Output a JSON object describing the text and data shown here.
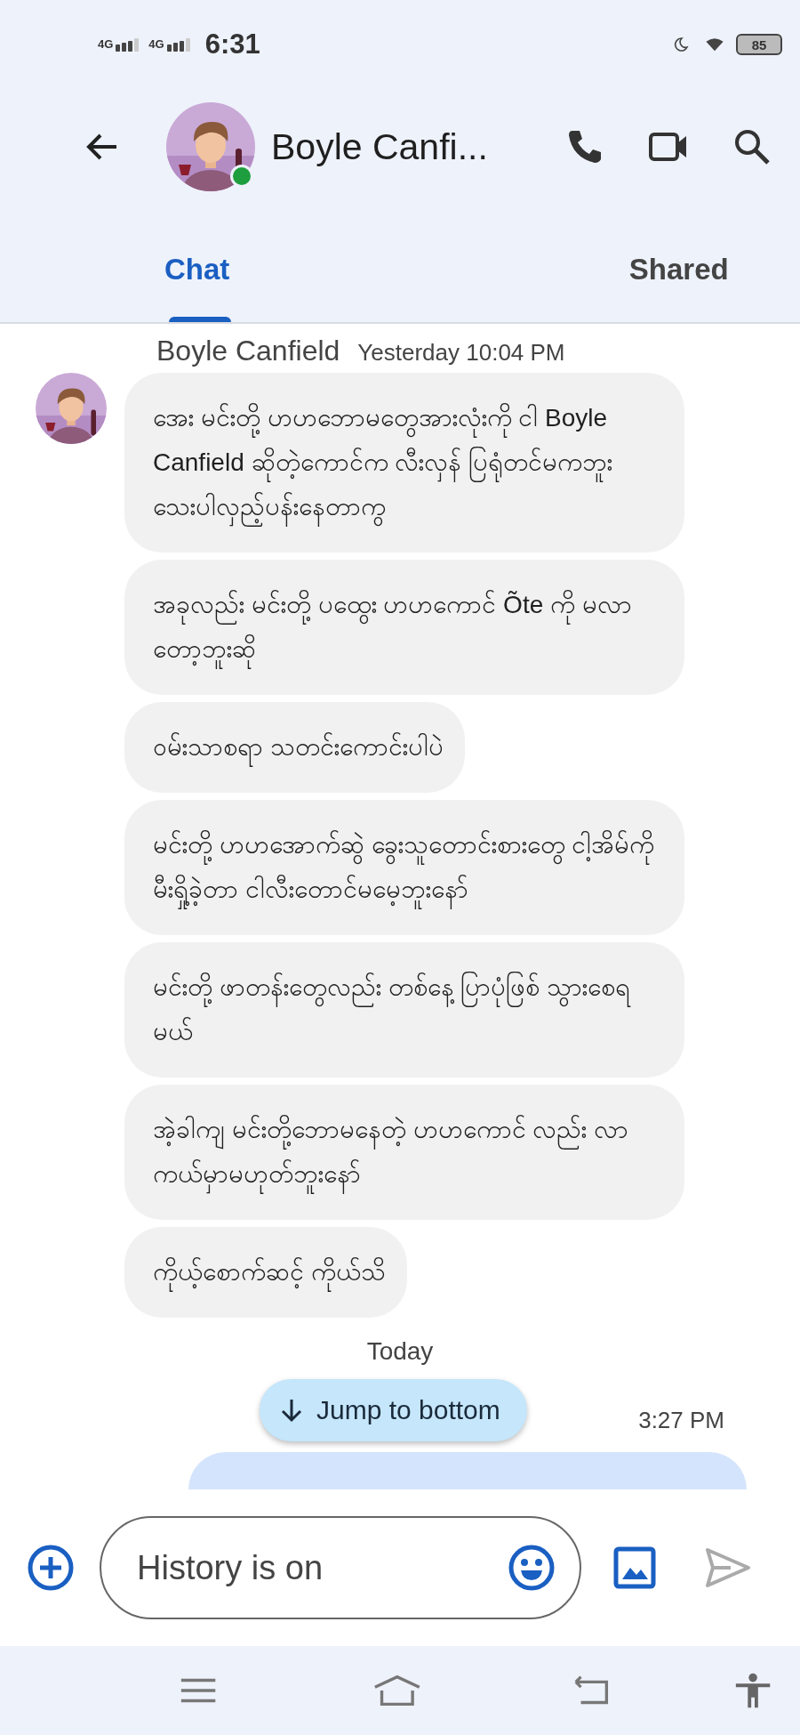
{
  "status_bar": {
    "networks": [
      "4G",
      "4G"
    ],
    "time": "6:31",
    "battery": "85"
  },
  "header": {
    "contact_name": "Boyle Canfi...",
    "online": true
  },
  "tabs": [
    {
      "label": "Chat",
      "selected": true
    },
    {
      "label": "Shared",
      "selected": false
    }
  ],
  "conversation": {
    "sender": "Boyle Canfield",
    "timestamp": "Yesterday 10:04 PM",
    "messages": [
      {
        "text": "အေး မင်းတို့ ဟဟဘောမတွေအားလုံးကို ငါ Boyle Canfield ဆိုတဲ့ကောင်က လီးလှန် ပြရုံတင်မကဘူး သေးပါလှည့်ပန်းနေတာကွ"
      },
      {
        "text": "အခုလည်း မင်းတို့ ပထွေး ဟဟကောင် Õte ကို မလာတော့ဘူးဆို"
      },
      {
        "text": "ဝမ်းသာစရာ သတင်းကောင်းပါပဲ"
      },
      {
        "text": "မင်းတို့ ဟဟအောက်ဆွဲ ခွေးသူတောင်းစားတွေ ငါ့အိမ်ကို မီးရှို့ခဲ့တာ ငါလီးတောင်မမေ့ဘူးနော်"
      },
      {
        "text": "မင်းတို့ ဖာတန်းတွေလည်း တစ်နေ့ ပြာပုံဖြစ် သွားစေရမယ်"
      },
      {
        "text": "အဲ့ခါကျ မင်းတို့ဘောမနေတဲ့ ဟဟကောင် လည်း လာကယ်မှာမဟုတ်ဘူးနော်"
      },
      {
        "text": "ကိုယ့်စောက်ဆင့် ကိုယ်သိ"
      }
    ],
    "day_divider": "Today",
    "jump_button": "Jump to bottom",
    "outgoing_time": "3:27 PM"
  },
  "composer": {
    "placeholder": "History is on"
  }
}
